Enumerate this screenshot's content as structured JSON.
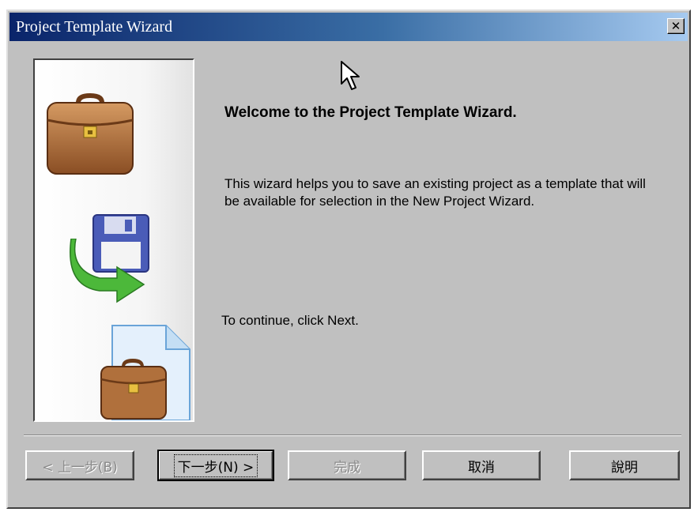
{
  "window": {
    "title": "Project Template Wizard",
    "close_label": "✕",
    "close_icon": "close-icon"
  },
  "side_panel": {
    "icons": [
      "briefcase-icon",
      "floppy-disk-icon",
      "green-arrow-icon",
      "document-briefcase-icon"
    ]
  },
  "content": {
    "heading": "Welcome to the Project Template Wizard.",
    "description": "This wizard helps you to save an existing project as a template that will be available for selection in the New Project Wizard.",
    "continue_text": "To continue, click Next."
  },
  "buttons": {
    "back": "< 上一步(B)",
    "next": "下一步(N) >",
    "finish": "完成",
    "cancel": "取消",
    "help": "說明"
  },
  "colors": {
    "titlebar_start": "#0a246a",
    "titlebar_end": "#a6caf0",
    "dialog_face": "#c0c0c0"
  }
}
